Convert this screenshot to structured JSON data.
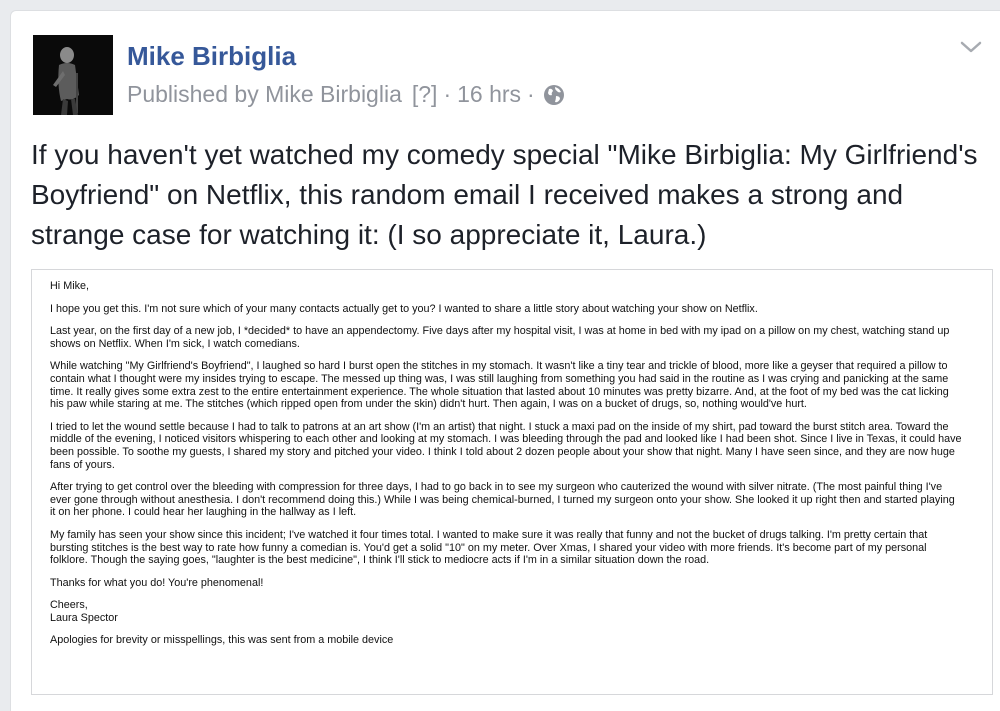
{
  "post": {
    "author": "Mike Birbiglia",
    "published_by": "Published by Mike Birbiglia",
    "help_marker": "[?]",
    "separator": "·",
    "time": "16 hrs",
    "text_lines": [
      "If you haven't yet watched my comedy special \"Mike Birbiglia: My Girlfriend's",
      "Boyfriend\" on Netflix, this random email I received makes a strong and",
      "strange case for watching it: (I so appreciate it, Laura.)"
    ]
  },
  "icons": {
    "menu": "chevron-down-icon",
    "audience": "globe-icon"
  },
  "colors": {
    "author_link": "#365899",
    "meta_gray": "#90949c",
    "page_bg": "#e9ebee"
  },
  "email": {
    "paragraphs": [
      [
        "Hi Mike,"
      ],
      [
        "I hope you get this. I'm not sure which of your many contacts actually get to you?  I wanted to share a little story about watching your show on Netflix."
      ],
      [
        "Last year, on the first day of a new job, I *decided* to have an appendectomy. Five days after my hospital visit, I was at home in bed with my ipad on a pillow on my chest, watching stand up",
        "shows on Netflix. When I'm sick, I watch comedians."
      ],
      [
        "While watching \"My Girlfriend's Boyfriend\", I laughed so hard I burst open the stitches in my stomach. It wasn't like a tiny tear and trickle of blood, more like a geyser that required a pillow to",
        "contain what I thought were my insides trying to escape. The messed up thing was, I was still laughing from something you had said in the routine as I was crying and panicking at the same",
        "time. It really gives some extra zest to the entire entertainment experience. The whole situation that lasted about 10 minutes was pretty bizarre. And, at the foot of my bed was the cat licking",
        "his paw while staring at me. The stitches (which ripped open from under the skin) didn't hurt. Then again, I was on a bucket of drugs, so, nothing would've hurt."
      ],
      [
        "I tried to let the wound settle because I had to talk to patrons at an art show (I'm an artist) that night. I stuck a maxi pad on the inside of my shirt, pad toward the burst stitch area. Toward the",
        "middle of the evening, I noticed visitors whispering to each other and looking at my stomach. I was bleeding through the pad and looked like I had been shot. Since I live in Texas, it could have",
        "been possible. To soothe my guests, I shared my story and pitched your video. I think I told about 2 dozen people about your show that night. Many I have seen since, and they are now huge",
        "fans of yours."
      ],
      [
        "After trying to get control over the bleeding with compression for three days, I had to go back in to see my surgeon who cauterized the wound with silver nitrate. (The most painful thing I've",
        "ever gone through without anesthesia. I don't recommend doing this.) While I was being chemical-burned, I turned my surgeon onto your show. She looked it up right then and started playing",
        "it on her phone. I could hear her laughing in the hallway as I left."
      ],
      [
        "My family has seen your show since this incident; I've watched it four times total. I wanted to make sure it was really that funny and not the bucket of drugs talking. I'm pretty certain that",
        "bursting stitches is the best way to rate how funny a comedian is. You'd get a solid \"10\" on my meter. Over Xmas, I shared your video with more friends. It's become part of my personal",
        "folklore. Though the saying goes, \"laughter is the best medicine\",  I think I'll stick to mediocre acts if I'm in a similar situation down the road."
      ],
      [
        "Thanks for what you do! You're phenomenal!"
      ],
      [
        "Cheers,",
        "Laura Spector"
      ],
      [
        "Apologies for brevity or misspellings, this was sent from a mobile device"
      ]
    ]
  }
}
